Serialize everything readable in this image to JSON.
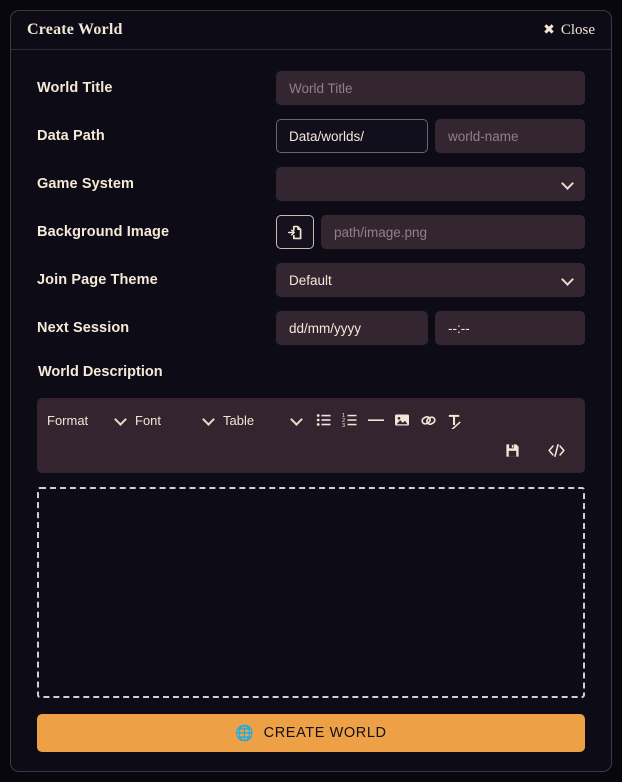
{
  "dialog": {
    "title": "Create World",
    "close_label": "Close",
    "close_icon": "close-x-icon"
  },
  "form": {
    "rows": [
      {
        "label": "World Title",
        "field": {
          "kind": "text",
          "value": "",
          "placeholder": "World Title"
        }
      },
      {
        "label": "Data Path",
        "prefix": {
          "kind": "text",
          "value": "Data/worlds/"
        },
        "field": {
          "kind": "text",
          "value": "",
          "placeholder": "world-name"
        }
      },
      {
        "label": "Game System",
        "field": {
          "kind": "select",
          "value": "",
          "icon": "chevron-down-icon"
        }
      },
      {
        "label": "Background Image",
        "button": {
          "icon": "file-import-icon"
        },
        "field": {
          "kind": "text",
          "value": "",
          "placeholder": "path/image.png"
        }
      },
      {
        "label": "Join Page Theme",
        "field": {
          "kind": "select",
          "value": "Default",
          "icon": "chevron-down-icon"
        }
      },
      {
        "label": "Next Session",
        "date": {
          "kind": "date",
          "value": "",
          "placeholder": "dd/mm/yyyy"
        },
        "time": {
          "kind": "time",
          "value": "",
          "placeholder": "--:--"
        }
      }
    ]
  },
  "description": {
    "label": "World Description",
    "toolbar": {
      "selects": [
        {
          "label": "Format",
          "icon": "chevron-down-icon"
        },
        {
          "label": "Font",
          "icon": "chevron-down-icon"
        },
        {
          "label": "Table",
          "icon": "chevron-down-icon"
        }
      ],
      "icons": [
        "bullet-list-icon",
        "numbered-list-icon",
        "horizontal-rule-icon",
        "image-icon",
        "link-icon",
        "clear-format-icon"
      ],
      "icons_row2": [
        "save-icon",
        "source-code-icon"
      ]
    },
    "content": ""
  },
  "submit": {
    "label": "CREATE WORLD",
    "icon": "globe-icon",
    "color": "#eda045"
  }
}
